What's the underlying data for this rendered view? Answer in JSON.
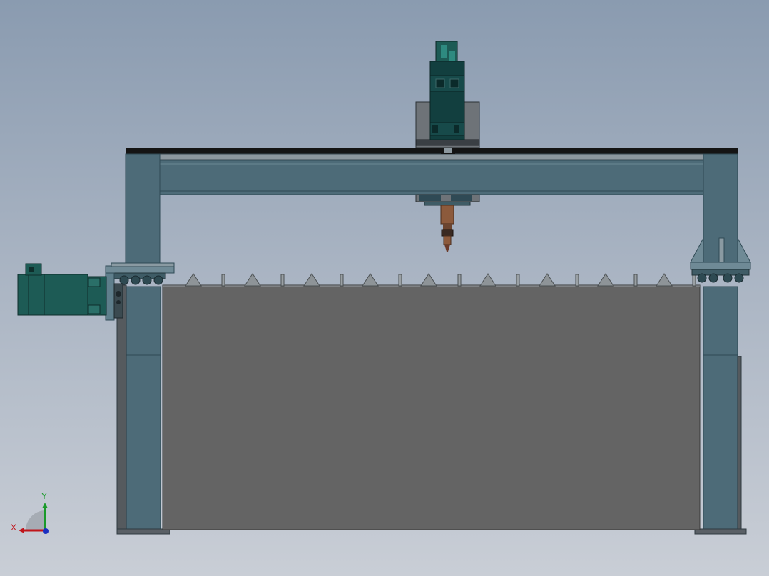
{
  "viewport": {
    "background_top": "#8a9bb0",
    "background_bottom": "#c9ced6"
  },
  "model": {
    "colors": {
      "frame": "#4d6b78",
      "frame_dark": "#2f4a55",
      "frame_light": "#5f7f8c",
      "bed": "#646464",
      "motor": "#1d5b55",
      "spindle": "#123f3f",
      "rail_black": "#141414",
      "plate_gray": "#6e7378",
      "nozzle": "#8c5a3c"
    },
    "icons": {
      "triad": "coordinate-triad-icon"
    }
  },
  "triad": {
    "x_label": "X",
    "y_label": "Y",
    "x_color": "#c0151b",
    "y_color": "#1a9a2a",
    "z_color": "#1a2fc0"
  }
}
